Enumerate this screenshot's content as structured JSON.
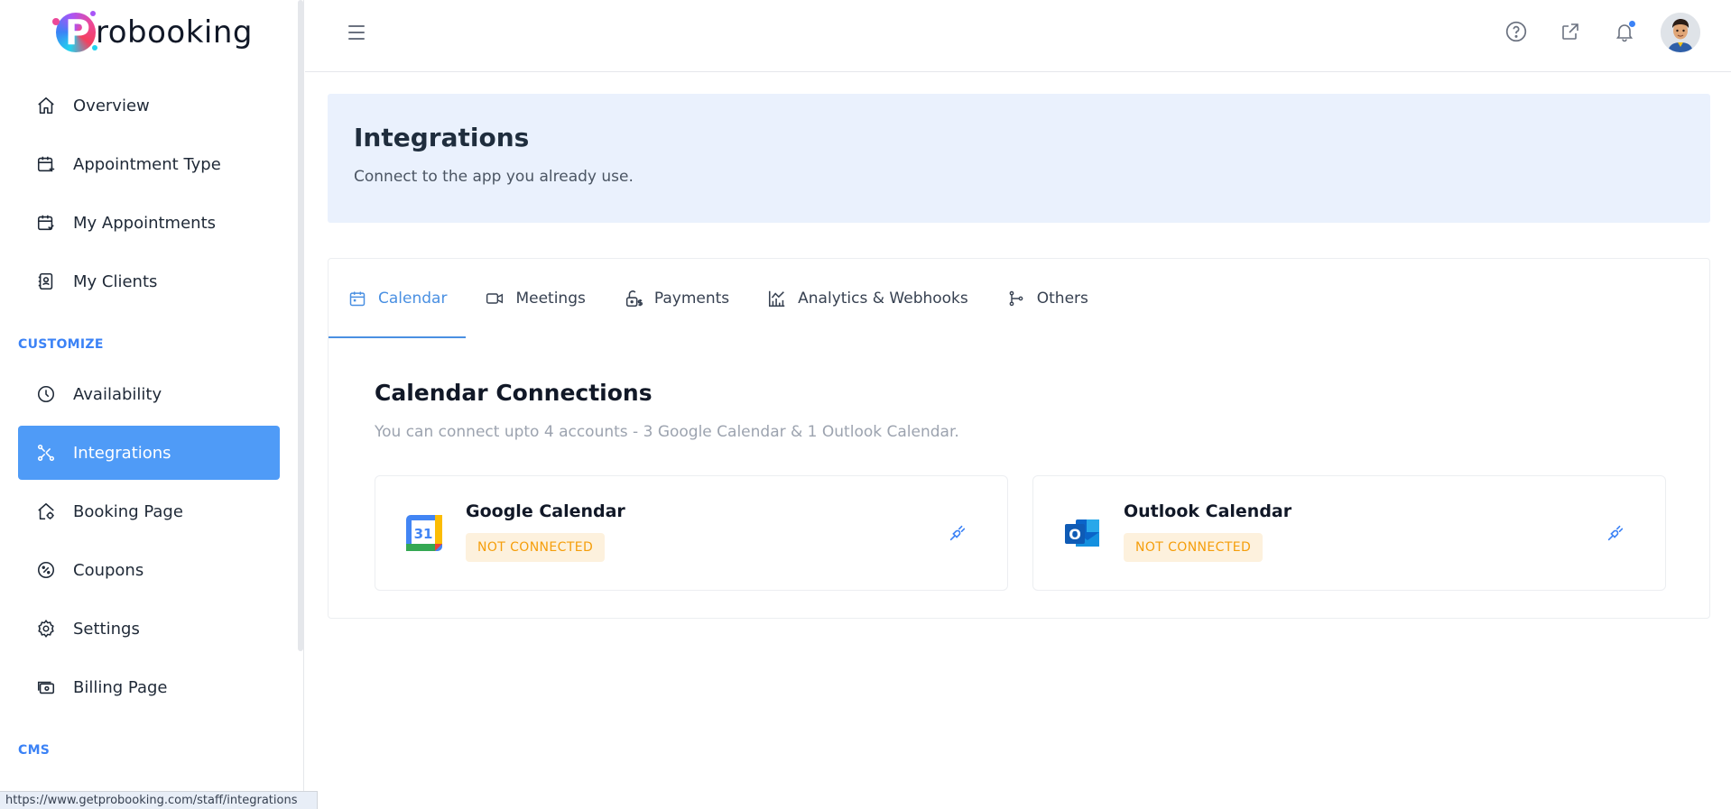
{
  "brand": {
    "logo_letter": "P",
    "logo_rest": "robooking"
  },
  "sidebar": {
    "items": [
      {
        "label": "Overview",
        "icon": "home-icon"
      },
      {
        "label": "Appointment Type",
        "icon": "calendar-plus-icon"
      },
      {
        "label": "My Appointments",
        "icon": "calendar-check-icon"
      },
      {
        "label": "My Clients",
        "icon": "contacts-icon"
      }
    ],
    "section_customize": "CUSTOMIZE",
    "customize_items": [
      {
        "label": "Availability",
        "icon": "clock-icon"
      },
      {
        "label": "Integrations",
        "icon": "integrations-icon",
        "active": true
      },
      {
        "label": "Booking Page",
        "icon": "home-gear-icon"
      },
      {
        "label": "Coupons",
        "icon": "percent-icon"
      },
      {
        "label": "Settings",
        "icon": "gear-icon"
      },
      {
        "label": "Billing Page",
        "icon": "billing-icon"
      }
    ],
    "section_cms": "CMS"
  },
  "status_bar_url": "https://www.getprobooking.com/staff/integrations",
  "header": {
    "title": "Integrations",
    "subtitle": "Connect to the app you already use."
  },
  "tabs": [
    {
      "label": "Calendar",
      "icon": "calendar-icon",
      "active": true
    },
    {
      "label": "Meetings",
      "icon": "video-icon"
    },
    {
      "label": "Payments",
      "icon": "lock-dollar-icon"
    },
    {
      "label": "Analytics & Webhooks",
      "icon": "chart-icon"
    },
    {
      "label": "Others",
      "icon": "branch-icon"
    }
  ],
  "calendar_section": {
    "title": "Calendar Connections",
    "subtitle": "You can connect upto 4 accounts - 3 Google Calendar & 1 Outlook Calendar."
  },
  "connections": [
    {
      "name": "Google Calendar",
      "status": "NOT CONNECTED",
      "logo_text": "31"
    },
    {
      "name": "Outlook Calendar",
      "status": "NOT CONNECTED",
      "logo_text": "O"
    }
  ],
  "colors": {
    "accent": "#4f9bf7",
    "badge_bg": "#fdf1dd",
    "badge_text": "#f59e0b",
    "banner_bg": "#eaf1fd"
  }
}
